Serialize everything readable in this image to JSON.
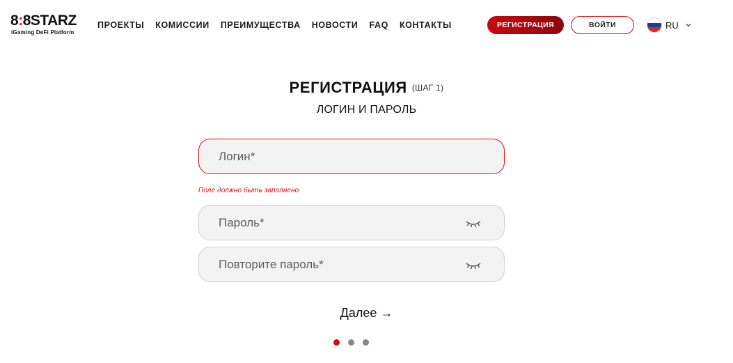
{
  "brand": {
    "logo_prefix": "8",
    "logo_mid": "8",
    "logo_main": "STARZ",
    "tagline": "iGaming DeFi Platform"
  },
  "nav": {
    "items": [
      {
        "label": "ПРОЕКТЫ"
      },
      {
        "label": "КОМИССИИ"
      },
      {
        "label": "ПРЕИМУЩЕСТВА"
      },
      {
        "label": "НОВОСТИ"
      },
      {
        "label": "FAQ"
      },
      {
        "label": "КОНТАКТЫ"
      }
    ]
  },
  "header": {
    "register_label": "РЕГИСТРАЦИЯ",
    "login_label": "ВОЙТИ",
    "language": "RU",
    "language_flag": "russia-flag",
    "colors": {
      "accent": "#d20a11",
      "accent_dark": "#8e0509"
    }
  },
  "form": {
    "title": "РЕГИСТРАЦИЯ",
    "step": "(ШАГ 1)",
    "subtitle": "ЛОГИН И ПАРОЛЬ",
    "login": {
      "value": "",
      "placeholder": "Логин*"
    },
    "login_error": "Поле должно быть заполнено",
    "password": {
      "value": "",
      "placeholder": "Пароль*",
      "icon": "eye-closed-icon"
    },
    "password_repeat": {
      "value": "",
      "placeholder": "Повторите пароль*",
      "icon": "eye-closed-icon"
    },
    "next_label": "Далее →",
    "steps": {
      "current": 1,
      "total": 3
    }
  }
}
